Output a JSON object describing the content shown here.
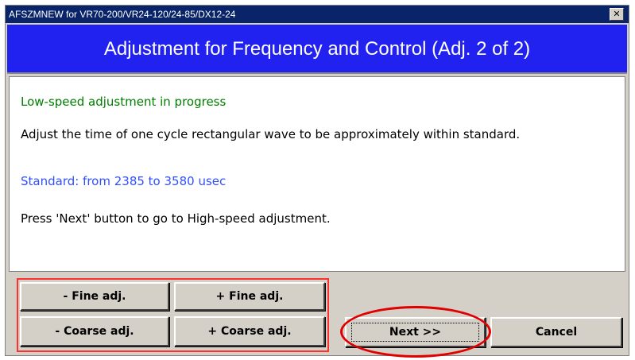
{
  "window": {
    "title": "AFSZMNEW for VR70-200/VR24-120/24-85/DX12-24",
    "close_label": "✕"
  },
  "header": {
    "title": "Adjustment for Frequency and Control (Adj. 2 of 2)"
  },
  "content": {
    "status": "Low-speed adjustment in progress",
    "instruction": "Adjust the time of one cycle rectangular wave to be approximately within standard.",
    "standard": "Standard: from 2385 to 3580 usec",
    "next_hint": "Press 'Next' button to go to High-speed adjustment."
  },
  "buttons": {
    "fine_minus": "- Fine adj.",
    "fine_plus": "+ Fine adj.",
    "coarse_minus": "- Coarse adj.",
    "coarse_plus": "+ Coarse adj.",
    "next": "Next >>",
    "cancel": "Cancel"
  },
  "colors": {
    "header_bg": "#2222f0",
    "status_text": "#008000",
    "standard_text": "#3050ff",
    "annotation": "#ff0000"
  }
}
